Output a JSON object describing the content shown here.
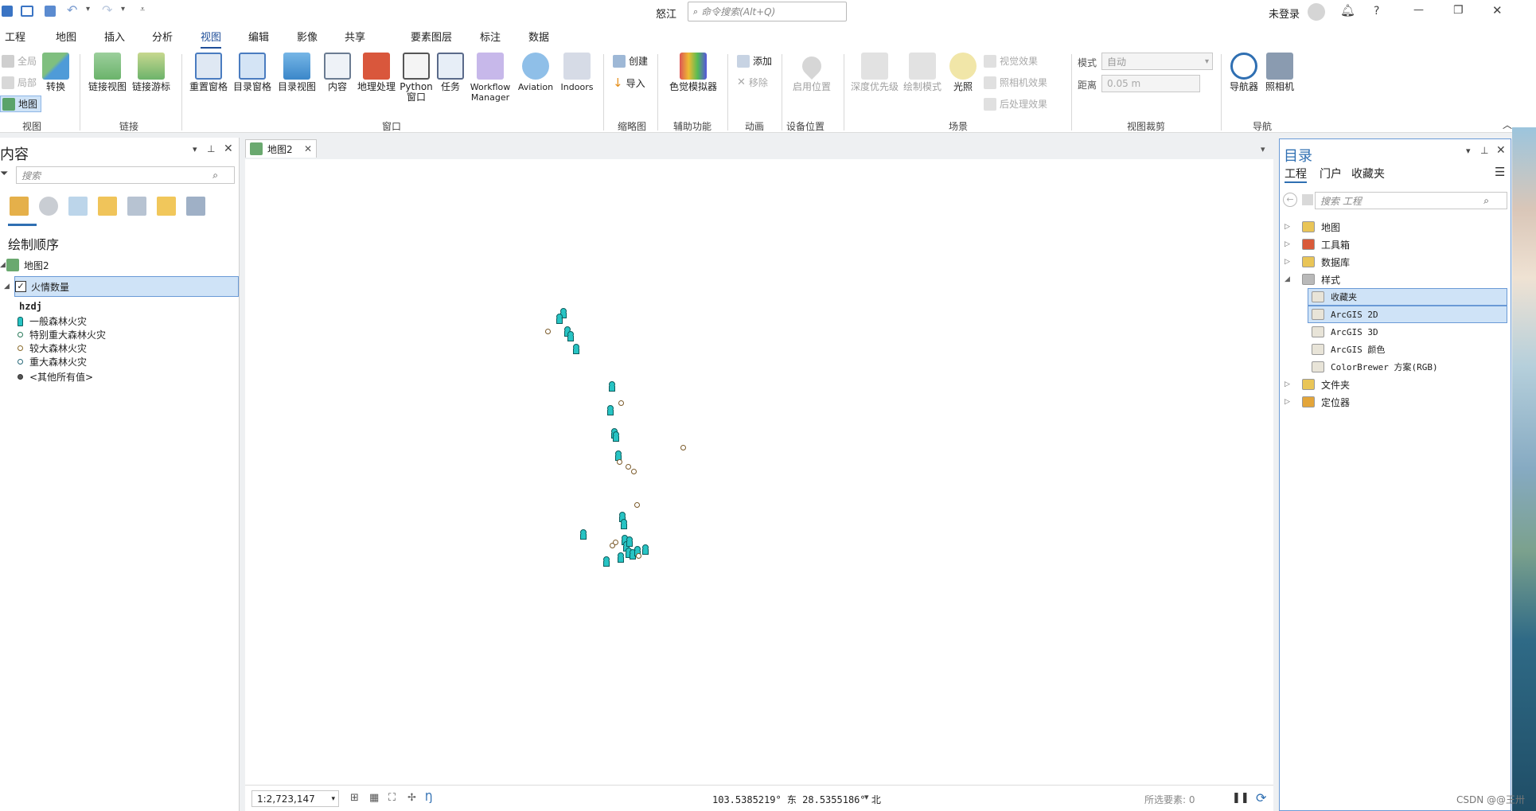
{
  "titlebar": {
    "app_title": "怒江",
    "search_placeholder": "命令搜索(Alt+Q)",
    "user_label": "未登录",
    "help_label": "?",
    "minimize": "—",
    "restore": "❐",
    "close": "✕"
  },
  "tabs": [
    "工程",
    "地图",
    "插入",
    "分析",
    "视图",
    "编辑",
    "影像",
    "共享"
  ],
  "active_tab": "视图",
  "context_tabs": [
    "要素图层",
    "标注",
    "数据"
  ],
  "ribbon": {
    "view_group": {
      "label": "视图",
      "full": "全局",
      "local": "局部",
      "map": "地图",
      "convert": "转换"
    },
    "link_group": {
      "label": "链接",
      "link_views": "链接视图",
      "link_cursor": "链接游标"
    },
    "window_group": {
      "label": "窗口",
      "items": [
        "重置窗格",
        "目录窗格",
        "目录视图",
        "内容",
        "地理处理",
        "Python 窗口",
        "任务",
        "Workflow Manager",
        "Aviation",
        "Indoors"
      ]
    },
    "thumb_group": {
      "label": "缩略图",
      "create": "创建",
      "import": "导入"
    },
    "access_group": {
      "label": "辅助功能",
      "color_sim": "色觉模拟器"
    },
    "anim_group": {
      "label": "动画",
      "add": "添加",
      "remove": "移除"
    },
    "device_group": {
      "label": "设备位置",
      "enable": "启用位置"
    },
    "scene_group": {
      "label": "场景",
      "depth": "深度优先级",
      "draw_mode": "绘制模式",
      "lighting": "光照",
      "visual_fx": "视觉效果",
      "camera_fx": "照相机效果",
      "post_fx": "后处理效果"
    },
    "clip_group": {
      "label": "视图裁剪",
      "mode_label": "模式",
      "mode_value": "自动",
      "distance_label": "距离",
      "distance_value": "0.05 m"
    },
    "nav_group": {
      "label": "导航",
      "navigator": "导航器",
      "camera": "照相机"
    }
  },
  "contents": {
    "title": "内容",
    "search_placeholder": "搜索",
    "section_title": "绘制顺序",
    "map_name": "地图2",
    "layer_name": "火情数量",
    "field_name": "hzdj",
    "legend": [
      {
        "label": "一般森林火灾",
        "icon": "person-marker-icon"
      },
      {
        "label": "特别重大森林火灾",
        "icon": "circle-icon"
      },
      {
        "label": "较大森林火灾",
        "icon": "circle-icon"
      },
      {
        "label": "重大森林火灾",
        "icon": "circle-icon"
      },
      {
        "label": "<其他所有值>",
        "icon": "filled-circle-icon"
      }
    ]
  },
  "map_view": {
    "tab_label": "地图2",
    "scale": "1:2,723,147",
    "coordinates": "103.5385219° 东 28.5355186° 北",
    "selected_features_label": "所选要素: 0"
  },
  "catalog": {
    "title": "目录",
    "tabs": [
      "工程",
      "门户",
      "收藏夹"
    ],
    "search_placeholder": "搜索 工程",
    "tree": [
      {
        "label": "地图",
        "level": 0,
        "expanded": false
      },
      {
        "label": "工具箱",
        "level": 0,
        "expanded": false
      },
      {
        "label": "数据库",
        "level": 0,
        "expanded": false
      },
      {
        "label": "样式",
        "level": 0,
        "expanded": true
      },
      {
        "label": "收藏夹",
        "level": 1,
        "selected": true
      },
      {
        "label": "ArcGIS 2D",
        "level": 1,
        "selected": true
      },
      {
        "label": "ArcGIS 3D",
        "level": 1
      },
      {
        "label": "ArcGIS 颜色",
        "level": 1
      },
      {
        "label": "ColorBrewer 方案(RGB)",
        "level": 1
      },
      {
        "label": "文件夹",
        "level": 0,
        "expanded": false
      },
      {
        "label": "定位器",
        "level": 0,
        "expanded": false
      }
    ]
  },
  "watermark": "CSDN @@王卅",
  "colors": {
    "accent": "#1f4e99",
    "selection": "#cfe3f7",
    "pin_fill": "#27c4c4"
  }
}
